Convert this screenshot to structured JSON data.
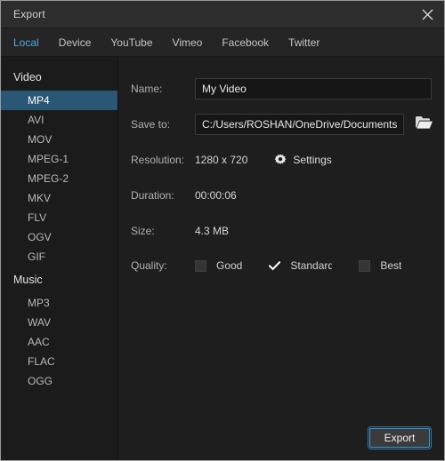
{
  "window": {
    "title": "Export",
    "close_icon": "close-icon"
  },
  "tabs": [
    {
      "label": "Local",
      "active": true
    },
    {
      "label": "Device",
      "active": false
    },
    {
      "label": "YouTube",
      "active": false
    },
    {
      "label": "Vimeo",
      "active": false
    },
    {
      "label": "Facebook",
      "active": false
    },
    {
      "label": "Twitter",
      "active": false
    }
  ],
  "sidebar": {
    "groups": [
      {
        "title": "Video",
        "items": [
          {
            "label": "MP4",
            "selected": true
          },
          {
            "label": "AVI",
            "selected": false
          },
          {
            "label": "MOV",
            "selected": false
          },
          {
            "label": "MPEG-1",
            "selected": false
          },
          {
            "label": "MPEG-2",
            "selected": false
          },
          {
            "label": "MKV",
            "selected": false
          },
          {
            "label": "FLV",
            "selected": false
          },
          {
            "label": "OGV",
            "selected": false
          },
          {
            "label": "GIF",
            "selected": false
          }
        ]
      },
      {
        "title": "Music",
        "items": [
          {
            "label": "MP3",
            "selected": false
          },
          {
            "label": "WAV",
            "selected": false
          },
          {
            "label": "AAC",
            "selected": false
          },
          {
            "label": "FLAC",
            "selected": false
          },
          {
            "label": "OGG",
            "selected": false
          }
        ]
      }
    ]
  },
  "form": {
    "name_label": "Name:",
    "name_value": "My Video",
    "name_placeholder": "My Video",
    "saveto_label": "Save to:",
    "saveto_value": "C:/Users/ROSHAN/OneDrive/Documents/i...",
    "saveto_placeholder": "C:/Users/ROSHAN/OneDrive/Documents/i...",
    "browse_icon": "folder-icon",
    "resolution_label": "Resolution:",
    "resolution_value": "1280 x 720",
    "settings_icon": "gear-icon",
    "settings_label": "Settings",
    "duration_label": "Duration:",
    "duration_value": "00:00:06",
    "size_label": "Size:",
    "size_value": "4.3 MB",
    "quality_label": "Quality:",
    "quality_options": [
      {
        "label": "Good",
        "checked": false,
        "clipped": false
      },
      {
        "label": "Standard",
        "checked": true,
        "clipped": true
      },
      {
        "label": "Best",
        "checked": false,
        "clipped": false
      }
    ]
  },
  "footer": {
    "export_label": "Export"
  },
  "colors": {
    "accent": "#53a8e2",
    "selection": "#2a5773",
    "focus_ring": "#3c9ad6",
    "window_bg": "#1e1e1e",
    "sidebar_bg": "#1b1b1b",
    "titlebar_bg": "#2d2d2d"
  }
}
